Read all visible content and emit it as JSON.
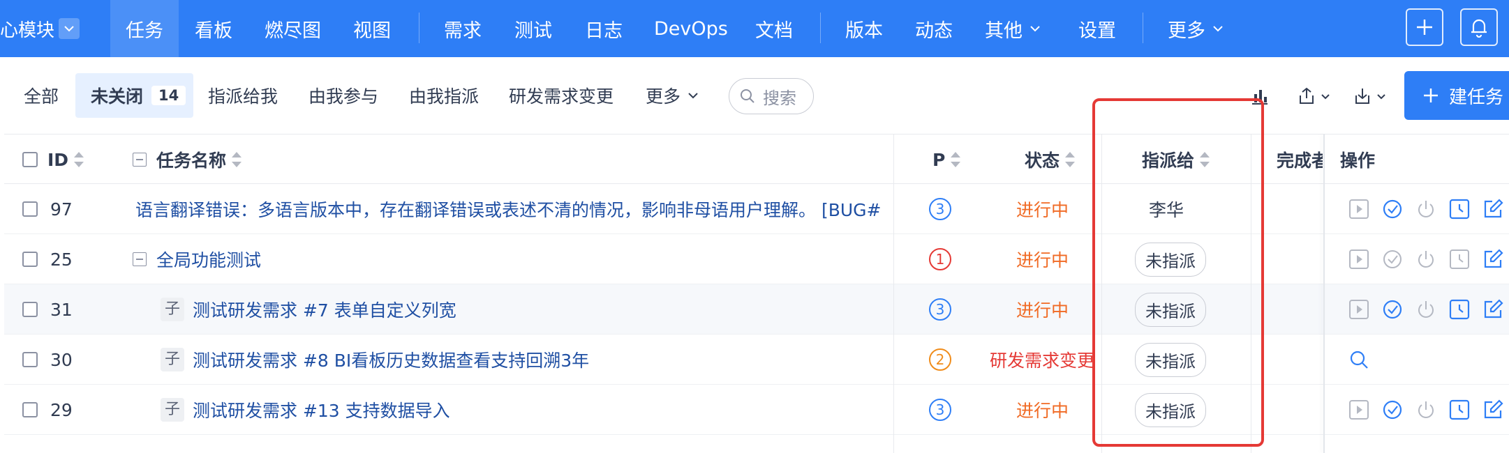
{
  "topnav": {
    "module": "心模块",
    "items": [
      "任务",
      "看板",
      "燃尽图",
      "视图",
      "需求",
      "测试",
      "日志",
      "DevOps",
      "文档",
      "版本",
      "动态",
      "其他",
      "设置",
      "更多"
    ],
    "accent": "#2e7ef6"
  },
  "filters": {
    "all": "全部",
    "unclosed": "未关闭",
    "unclosed_count": "14",
    "assigned_to_me": "指派给我",
    "involved": "由我参与",
    "assigned_by_me": "由我指派",
    "rd_change": "研发需求变更",
    "more": "更多",
    "search_placeholder": "搜索",
    "create_button": "建任务"
  },
  "table": {
    "headers": {
      "id": "ID",
      "name": "任务名称",
      "priority": "P",
      "status": "状态",
      "assigned_to": "指派给",
      "finished_by": "完成者",
      "actions": "操作"
    },
    "rows": [
      {
        "id": "97",
        "name": "语言翻译错误：多语言版本中，存在翻译错误或表述不清的情况，影响非母语用户理解。 [BUG#",
        "child": "",
        "priority": "3",
        "status": "进行中",
        "assigned": "李华"
      },
      {
        "id": "25",
        "name": "全局功能测试",
        "child": "",
        "priority": "1",
        "status": "进行中",
        "assigned": "未指派"
      },
      {
        "id": "31",
        "name": "测试研发需求 #7 表单自定义列宽",
        "child": "子",
        "priority": "3",
        "status": "进行中",
        "assigned": "未指派"
      },
      {
        "id": "30",
        "name": "测试研发需求 #8 BI看板历史数据查看支持回溯3年",
        "child": "子",
        "priority": "2",
        "status": "研发需求变更",
        "assigned": "未指派"
      },
      {
        "id": "29",
        "name": "测试研发需求 #13 支持数据导入",
        "child": "子",
        "priority": "3",
        "status": "进行中",
        "assigned": "未指派"
      }
    ]
  },
  "colors": {
    "pri1": "#e53935",
    "pri2": "#f08c1a",
    "pri3": "#2e7ef6",
    "status_doing": "#f06a24",
    "status_change": "#e53935",
    "highlight_box": "#e53935"
  }
}
